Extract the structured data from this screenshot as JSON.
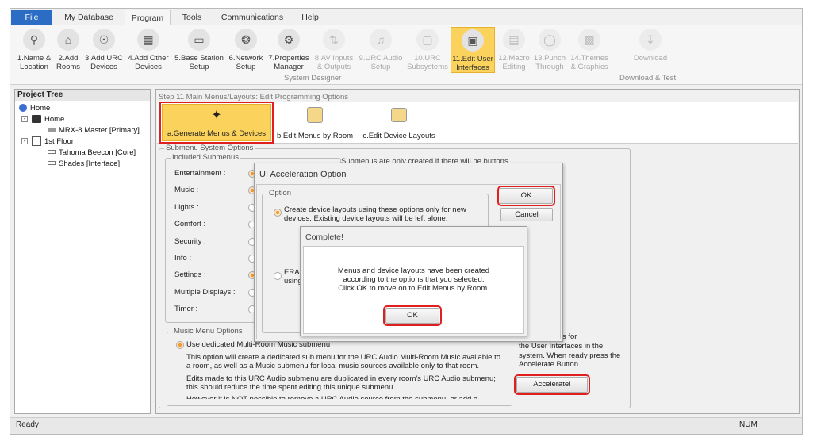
{
  "tabs": [
    "File",
    "My Database",
    "Program",
    "Tools",
    "Communications",
    "Help"
  ],
  "ribbon": [
    {
      "l1": "1.Name &",
      "l2": "Location",
      "icon": "location-icon",
      "g": "&#9906;",
      "st": ""
    },
    {
      "l1": "2.Add",
      "l2": "Rooms",
      "icon": "add-room-icon",
      "g": "&#8962;",
      "st": ""
    },
    {
      "l1": "3.Add URC",
      "l2": "Devices",
      "icon": "add-device-icon",
      "g": "&#9737;",
      "st": ""
    },
    {
      "l1": "4.Add Other",
      "l2": "Devices",
      "icon": "add-other-device-icon",
      "g": "&#9638;",
      "st": ""
    },
    {
      "l1": "5.Base Station",
      "l2": "Setup",
      "icon": "base-station-icon",
      "g": "&#9645;",
      "st": ""
    },
    {
      "l1": "6.Network",
      "l2": "Setup",
      "icon": "network-icon",
      "g": "&#10050;",
      "st": ""
    },
    {
      "l1": "7.Properties",
      "l2": "Manager",
      "icon": "properties-icon",
      "g": "&#9881;",
      "st": ""
    },
    {
      "l1": "8.AV Inputs",
      "l2": "& Outputs",
      "icon": "av-io-icon",
      "g": "&#8645;",
      "st": "dis"
    },
    {
      "l1": "9.URC Audio",
      "l2": "Setup",
      "icon": "audio-icon",
      "g": "&#9835;",
      "st": "dis"
    },
    {
      "l1": "10.URC",
      "l2": "Subsystems",
      "icon": "subsystems-icon",
      "g": "&#9634;",
      "st": "dis"
    },
    {
      "l1": "11.Edit User",
      "l2": "Interfaces",
      "icon": "edit-ui-icon",
      "g": "&#9635;",
      "st": "sel"
    },
    {
      "l1": "12.Macro",
      "l2": "Editing",
      "icon": "macro-icon",
      "g": "&#9636;",
      "st": "dis"
    },
    {
      "l1": "13.Punch",
      "l2": "Through",
      "icon": "punch-through-icon",
      "g": "&#9711;",
      "st": "dis"
    },
    {
      "l1": "14.Themes",
      "l2": "& Graphics",
      "icon": "themes-icon",
      "g": "&#9641;",
      "st": "dis"
    },
    {
      "l1": "Download",
      "l2": "",
      "icon": "download-icon",
      "g": "&#8615;",
      "st": "dis"
    }
  ],
  "groups": {
    "designer": "System Designer",
    "download": "Download & Test"
  },
  "tree": {
    "header": "Project Tree",
    "items": [
      "Home",
      "Home",
      "MRX-8 Master [Primary]",
      "1st Floor",
      "Tahoma Beecon [Core]",
      "Shades [Interface]"
    ]
  },
  "breadcrumb": "Step 11 Main Menus/Layouts: Edit Programming Options",
  "subtools": [
    "a.Generate Menus & Devices",
    "b.Edit Menus by Room",
    "c.Edit Device Layouts"
  ],
  "submenu": {
    "title": "Submenu System Options",
    "included": "Included Submenus",
    "labels": [
      "Entertainment :",
      "Music :",
      "Lights :",
      "Comfort :",
      "Security :",
      "Info :",
      "Settings :",
      "Multiple Displays :",
      "Timer :"
    ],
    "note": "Submenus are only created if there will be buttons"
  },
  "music": {
    "title": "Music Menu Options",
    "option": "Use dedicated Multi-Room Music submenu",
    "lines": [
      "This option will create a dedicated sub menu for the URC Audio Multi-Room Music available to",
      "a room, as well as a Music submenu for local music sources available only to that room.",
      "Edits made to this URC Audio submenu are duplicated in every room's URC Audio submenu;",
      "this should reduce the time spent editing this unique submenu.",
      "However it is NOT possible to remove a URC Audio source from the submenu, or add a"
    ]
  },
  "side_text": [
    "...etup options for",
    "the User Interfaces in the",
    "system. When ready press the",
    "Accelerate Button"
  ],
  "accelerate": "Accelerate!",
  "accel_dialog": {
    "title": "UI Acceleration Option",
    "group": "Option",
    "opt1a": "Create device layouts using these options only for new",
    "opt1b": "devices. Existing device layouts will be left alone.",
    "opt2a": "ERAS",
    "opt2b": "using",
    "ok": "OK",
    "cancel": "Cancel"
  },
  "complete": {
    "title": "Complete!",
    "lines": [
      "Menus and device layouts have been created",
      "according to the options that you selected.",
      "Click OK to move on to Edit Menus by Room."
    ],
    "ok": "OK"
  },
  "status": {
    "text": "Ready",
    "num": "NUM"
  }
}
